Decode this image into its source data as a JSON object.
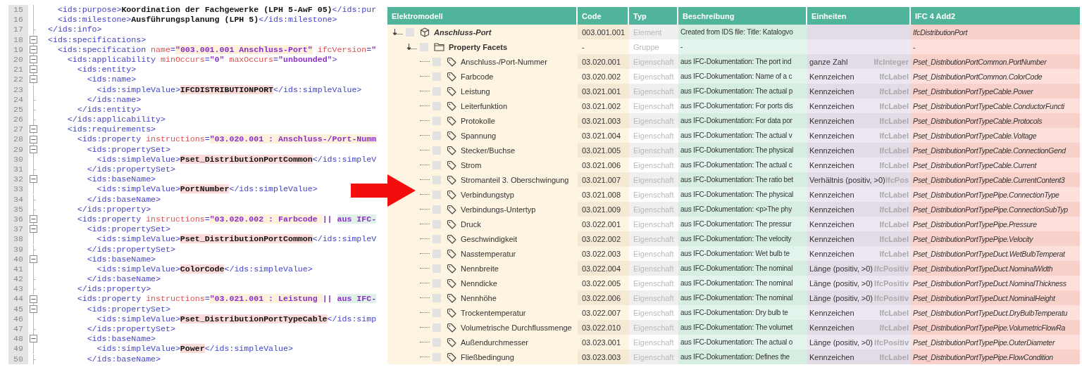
{
  "editor": {
    "lines": [
      {
        "number": "15",
        "kind": "line",
        "tokens": [
          {
            "kind": "tag",
            "text": "  <ids:purpose>"
          },
          {
            "kind": "text",
            "text": "Koordination der Fachgewerke (LPH 5-AwF 05)"
          },
          {
            "kind": "tag",
            "text": "</ids:pur"
          }
        ]
      },
      {
        "number": "16",
        "kind": "line",
        "tokens": [
          {
            "kind": "tag",
            "text": "  <ids:milestone>"
          },
          {
            "kind": "text",
            "text": "Ausführungsplanung (LPH 5)"
          },
          {
            "kind": "tag",
            "text": "</ids:milestone>"
          }
        ]
      },
      {
        "number": "17",
        "kind": "end",
        "tokens": [
          {
            "kind": "tag",
            "text": "</ids:info>"
          }
        ]
      },
      {
        "number": "18",
        "kind": "open",
        "tokens": [
          {
            "kind": "tag",
            "text": "<ids:specifications>"
          }
        ]
      },
      {
        "number": "19",
        "kind": "open",
        "tokens": [
          {
            "kind": "tag",
            "text": "  <ids:specification "
          },
          {
            "kind": "attr",
            "text": "name"
          },
          {
            "kind": "tag",
            "text": "="
          },
          {
            "kind": "value-mark",
            "text": "\"003.001.001 Anschluss-Port\""
          },
          {
            "kind": "attr",
            "text": " ifcVersion"
          },
          {
            "kind": "tag",
            "text": "="
          },
          {
            "kind": "value",
            "text": "\""
          }
        ]
      },
      {
        "number": "20",
        "kind": "open",
        "tokens": [
          {
            "kind": "tag",
            "text": "    <ids:applicability "
          },
          {
            "kind": "attr",
            "text": "minOccurs"
          },
          {
            "kind": "tag",
            "text": "="
          },
          {
            "kind": "value",
            "text": "\"0\""
          },
          {
            "kind": "attr",
            "text": " maxOccurs"
          },
          {
            "kind": "tag",
            "text": "="
          },
          {
            "kind": "value",
            "text": "\"unbounded\""
          },
          {
            "kind": "tag",
            "text": ">"
          }
        ]
      },
      {
        "number": "21",
        "kind": "open",
        "tokens": [
          {
            "kind": "tag",
            "text": "      <ids:entity>"
          }
        ]
      },
      {
        "number": "22",
        "kind": "open",
        "tokens": [
          {
            "kind": "tag",
            "text": "        <ids:name>"
          }
        ]
      },
      {
        "number": "23",
        "kind": "line",
        "tokens": [
          {
            "kind": "tag",
            "text": "          <ids:simpleValue>"
          },
          {
            "kind": "text-mark",
            "text": "IFCDISTRIBUTIONPORT"
          },
          {
            "kind": "tag",
            "text": "</ids:simpleValue>"
          }
        ]
      },
      {
        "number": "24",
        "kind": "end",
        "tokens": [
          {
            "kind": "tag",
            "text": "        </ids:name>"
          }
        ]
      },
      {
        "number": "25",
        "kind": "end",
        "tokens": [
          {
            "kind": "tag",
            "text": "      </ids:entity>"
          }
        ]
      },
      {
        "number": "26",
        "kind": "end",
        "tokens": [
          {
            "kind": "tag",
            "text": "    </ids:applicability>"
          }
        ]
      },
      {
        "number": "27",
        "kind": "open",
        "tokens": [
          {
            "kind": "tag",
            "text": "    <ids:requirements>"
          }
        ]
      },
      {
        "number": "28",
        "kind": "open",
        "tokens": [
          {
            "kind": "tag",
            "text": "      <ids:property "
          },
          {
            "kind": "attr",
            "text": "instructions"
          },
          {
            "kind": "tag",
            "text": "="
          },
          {
            "kind": "value-mark",
            "text": "\"03.020.001 : Anschluss-/Port-Numm"
          }
        ]
      },
      {
        "number": "29",
        "kind": "open",
        "tokens": [
          {
            "kind": "tag",
            "text": "        <ids:propertySet>"
          }
        ]
      },
      {
        "number": "30",
        "kind": "line",
        "tokens": [
          {
            "kind": "tag",
            "text": "          <ids:simpleValue>"
          },
          {
            "kind": "text-mark",
            "text": "Pset_DistributionPortCommon"
          },
          {
            "kind": "tag",
            "text": "</ids:simpleV"
          }
        ]
      },
      {
        "number": "31",
        "kind": "end",
        "tokens": [
          {
            "kind": "tag",
            "text": "        </ids:propertySet>"
          }
        ]
      },
      {
        "number": "32",
        "kind": "open",
        "tokens": [
          {
            "kind": "tag",
            "text": "        <ids:baseName>"
          }
        ]
      },
      {
        "number": "33",
        "kind": "line",
        "tokens": [
          {
            "kind": "tag",
            "text": "          <ids:simpleValue>"
          },
          {
            "kind": "text-mark",
            "text": "PortNumber"
          },
          {
            "kind": "tag",
            "text": "</ids:simpleValue>"
          }
        ]
      },
      {
        "number": "34",
        "kind": "end",
        "tokens": [
          {
            "kind": "tag",
            "text": "        </ids:baseName>"
          }
        ]
      },
      {
        "number": "35",
        "kind": "end",
        "tokens": [
          {
            "kind": "tag",
            "text": "      </ids:property>"
          }
        ]
      },
      {
        "number": "36",
        "kind": "open",
        "tokens": [
          {
            "kind": "tag",
            "text": "      <ids:property "
          },
          {
            "kind": "attr",
            "text": "instructions"
          },
          {
            "kind": "tag",
            "text": "="
          },
          {
            "kind": "value-mark",
            "text": "\"03.020.002 : Farbcode "
          },
          {
            "kind": "value",
            "text": "|| "
          },
          {
            "kind": "value-note",
            "text": "aus IFC-"
          }
        ]
      },
      {
        "number": "37",
        "kind": "open",
        "tokens": [
          {
            "kind": "tag",
            "text": "        <ids:propertySet>"
          }
        ]
      },
      {
        "number": "38",
        "kind": "line",
        "tokens": [
          {
            "kind": "tag",
            "text": "          <ids:simpleValue>"
          },
          {
            "kind": "text-mark",
            "text": "Pset_DistributionPortCommon"
          },
          {
            "kind": "tag",
            "text": "</ids:simpleV"
          }
        ]
      },
      {
        "number": "39",
        "kind": "end",
        "tokens": [
          {
            "kind": "tag",
            "text": "        </ids:propertySet>"
          }
        ]
      },
      {
        "number": "40",
        "kind": "open",
        "tokens": [
          {
            "kind": "tag",
            "text": "        <ids:baseName>"
          }
        ]
      },
      {
        "number": "41",
        "kind": "line",
        "tokens": [
          {
            "kind": "tag",
            "text": "          <ids:simpleValue>"
          },
          {
            "kind": "text-mark",
            "text": "ColorCode"
          },
          {
            "kind": "tag",
            "text": "</ids:simpleValue>"
          }
        ]
      },
      {
        "number": "42",
        "kind": "end",
        "tokens": [
          {
            "kind": "tag",
            "text": "        </ids:baseName>"
          }
        ]
      },
      {
        "number": "43",
        "kind": "end",
        "tokens": [
          {
            "kind": "tag",
            "text": "      </ids:property>"
          }
        ]
      },
      {
        "number": "44",
        "kind": "open",
        "tokens": [
          {
            "kind": "tag",
            "text": "      <ids:property "
          },
          {
            "kind": "attr",
            "text": "instructions"
          },
          {
            "kind": "tag",
            "text": "="
          },
          {
            "kind": "value-mark",
            "text": "\"03.021.001 : Leistung "
          },
          {
            "kind": "value",
            "text": "|| "
          },
          {
            "kind": "value-note",
            "text": "aus IFC-"
          }
        ]
      },
      {
        "number": "45",
        "kind": "open",
        "tokens": [
          {
            "kind": "tag",
            "text": "        <ids:propertySet>"
          }
        ]
      },
      {
        "number": "46",
        "kind": "line",
        "tokens": [
          {
            "kind": "tag",
            "text": "          <ids:simpleValue>"
          },
          {
            "kind": "text-mark",
            "text": "Pset_DistributionPortTypeCable"
          },
          {
            "kind": "tag",
            "text": "</ids:simp"
          }
        ]
      },
      {
        "number": "47",
        "kind": "end",
        "tokens": [
          {
            "kind": "tag",
            "text": "        </ids:propertySet>"
          }
        ]
      },
      {
        "number": "48",
        "kind": "open",
        "tokens": [
          {
            "kind": "tag",
            "text": "        <ids:baseName>"
          }
        ]
      },
      {
        "number": "49",
        "kind": "line",
        "tokens": [
          {
            "kind": "tag",
            "text": "          <ids:simpleValue>"
          },
          {
            "kind": "text-mark",
            "text": "Power"
          },
          {
            "kind": "tag",
            "text": "</ids:simpleValue>"
          }
        ]
      },
      {
        "number": "50",
        "kind": "end",
        "tokens": [
          {
            "kind": "tag",
            "text": "        </ids:baseName>"
          }
        ]
      }
    ]
  },
  "table": {
    "columns": [
      "Elektromodell",
      "Code",
      "Typ",
      "Beschreibung",
      "Einheiten",
      "IFC 4 Add2"
    ],
    "tree": [
      {
        "kind": "element",
        "name": "Anschluss-Port",
        "code": "003.001.001",
        "type": "Element",
        "description": "Created from IDS file: Title: Katalogvo",
        "ifc": "IfcDistributionPort",
        "checked": false,
        "expanded": true,
        "children": [
          {
            "kind": "group",
            "name": "Property Facets",
            "code": "-",
            "type": "Gruppe",
            "description": "-",
            "ifc": "-",
            "checked": false,
            "expanded": true,
            "children": [
              {
                "kind": "property",
                "name": "Anschluss-/Port-Nummer",
                "code": "03.020.001",
                "type": "Eigenschaft",
                "description": "aus IFC-Dokumentation: The port ind",
                "unit": "ganze Zahl",
                "unit_type": "IfcInteger",
                "ifc": "Pset_DistributionPortCommon.PortNumber",
                "checked": false
              },
              {
                "kind": "property",
                "name": "Farbcode",
                "code": "03.020.002",
                "type": "Eigenschaft",
                "description": "aus IFC-Dokumentation: Name of a c",
                "unit": "Kennzeichen",
                "unit_type": "IfcLabel",
                "ifc": "Pset_DistributionPortCommon.ColorCode",
                "checked": false
              },
              {
                "kind": "property",
                "name": "Leistung",
                "code": "03.021.001",
                "type": "Eigenschaft",
                "description": "aus IFC-Dokumentation: The actual p",
                "unit": "Kennzeichen",
                "unit_type": "IfcLabel",
                "ifc": "Pset_DistributionPortTypeCable.Power",
                "checked": false
              },
              {
                "kind": "property",
                "name": "Leiterfunktion",
                "code": "03.021.002",
                "type": "Eigenschaft",
                "description": "aus IFC-Dokumentation: For ports dis",
                "unit": "Kennzeichen",
                "unit_type": "IfcLabel",
                "ifc": "Pset_DistributionPortTypeCable.ConductorFuncti",
                "checked": false
              },
              {
                "kind": "property",
                "name": "Protokolle",
                "code": "03.021.003",
                "type": "Eigenschaft",
                "description": "aus IFC-Dokumentation: For data por",
                "unit": "Kennzeichen",
                "unit_type": "IfcLabel",
                "ifc": "Pset_DistributionPortTypeCable.Protocols",
                "checked": false
              },
              {
                "kind": "property",
                "name": "Spannung",
                "code": "03.021.004",
                "type": "Eigenschaft",
                "description": "aus IFC-Dokumentation: The actual v",
                "unit": "Kennzeichen",
                "unit_type": "IfcLabel",
                "ifc": "Pset_DistributionPortTypeCable.Voltage",
                "checked": false
              },
              {
                "kind": "property",
                "name": "Stecker/Buchse",
                "code": "03.021.005",
                "type": "Eigenschaft",
                "description": "aus IFC-Dokumentation: The physical",
                "unit": "Kennzeichen",
                "unit_type": "IfcLabel",
                "ifc": "Pset_DistributionPortTypeCable.ConnectionGend",
                "checked": false
              },
              {
                "kind": "property",
                "name": "Strom",
                "code": "03.021.006",
                "type": "Eigenschaft",
                "description": "aus IFC-Dokumentation: The actual c",
                "unit": "Kennzeichen",
                "unit_type": "IfcLabel",
                "ifc": "Pset_DistributionPortTypeCable.Current",
                "checked": false
              },
              {
                "kind": "property",
                "name": "Stromanteil 3. Oberschwingung",
                "code": "03.021.007",
                "type": "Eigenschaft",
                "description": "aus IFC-Dokumentation: The ratio bet",
                "unit": "Verhältnis (positiv, >0)",
                "unit_type": "IfcPos",
                "ifc": "Pset_DistributionPortTypeCable.CurrentContent3",
                "checked": false
              },
              {
                "kind": "property",
                "name": "Verbindungstyp",
                "code": "03.021.008",
                "type": "Eigenschaft",
                "description": "aus IFC-Dokumentation: The physical",
                "unit": "Kennzeichen",
                "unit_type": "IfcLabel",
                "ifc": "Pset_DistributionPortTypePipe.ConnectionType",
                "checked": false
              },
              {
                "kind": "property",
                "name": "Verbindungs-Untertyp",
                "code": "03.021.009",
                "type": "Eigenschaft",
                "description": "aus IFC-Dokumentation: <p>The phy",
                "unit": "Kennzeichen",
                "unit_type": "IfcLabel",
                "ifc": "Pset_DistributionPortTypePipe.ConnectionSubTyp",
                "checked": false
              },
              {
                "kind": "property",
                "name": "Druck",
                "code": "03.022.001",
                "type": "Eigenschaft",
                "description": "aus IFC-Dokumentation: The pressur",
                "unit": "Kennzeichen",
                "unit_type": "IfcLabel",
                "ifc": "Pset_DistributionPortTypePipe.Pressure",
                "checked": false
              },
              {
                "kind": "property",
                "name": "Geschwindigkeit",
                "code": "03.022.002",
                "type": "Eigenschaft",
                "description": "aus IFC-Dokumentation: The velocity",
                "unit": "Kennzeichen",
                "unit_type": "IfcLabel",
                "ifc": "Pset_DistributionPortTypePipe.Velocity",
                "checked": false
              },
              {
                "kind": "property",
                "name": "Nasstemperatur",
                "code": "03.022.003",
                "type": "Eigenschaft",
                "description": "aus IFC-Dokumentation: Wet bulb te",
                "unit": "Kennzeichen",
                "unit_type": "IfcLabel",
                "ifc": "Pset_DistributionPortTypeDuct.WetBulbTemperat",
                "checked": false
              },
              {
                "kind": "property",
                "name": "Nennbreite",
                "code": "03.022.004",
                "type": "Eigenschaft",
                "description": "aus IFC-Dokumentation: The nominal",
                "unit": "Länge (positiv, >0)",
                "unit_type": "IfcPositiv",
                "ifc": "Pset_DistributionPortTypeDuct.NominalWidth",
                "checked": false
              },
              {
                "kind": "property",
                "name": "Nenndicke",
                "code": "03.022.005",
                "type": "Eigenschaft",
                "description": "aus IFC-Dokumentation: The nominal",
                "unit": "Länge (positiv, >0)",
                "unit_type": "IfcPositiv",
                "ifc": "Pset_DistributionPortTypeDuct.NominalThickness",
                "checked": false
              },
              {
                "kind": "property",
                "name": "Nennhöhe",
                "code": "03.022.006",
                "type": "Eigenschaft",
                "description": "aus IFC-Dokumentation: The nominal",
                "unit": "Länge (positiv, >0)",
                "unit_type": "IfcPositiv",
                "ifc": "Pset_DistributionPortTypeDuct.NominalHeight",
                "checked": false
              },
              {
                "kind": "property",
                "name": "Trockentemperatur",
                "code": "03.022.007",
                "type": "Eigenschaft",
                "description": "aus IFC-Dokumentation: Dry bulb te",
                "unit": "Kennzeichen",
                "unit_type": "IfcLabel",
                "ifc": "Pset_DistributionPortTypeDuct.DryBulbTemperatu",
                "checked": false
              },
              {
                "kind": "property",
                "name": "Volumetrische Durchflussmenge",
                "code": "03.022.010",
                "type": "Eigenschaft",
                "description": "aus IFC-Dokumentation: The volumet",
                "unit": "Kennzeichen",
                "unit_type": "IfcLabel",
                "ifc": "Pset_DistributionPortTypePipe.VolumetricFlowRa",
                "checked": false
              },
              {
                "kind": "property",
                "name": "Außendurchmesser",
                "code": "03.023.001",
                "type": "Eigenschaft",
                "description": "aus IFC-Dokumentation: The actual o",
                "unit": "Länge (positiv, >0)",
                "unit_type": "IfcPositiv",
                "ifc": "Pset_DistributionPortTypePipe.OuterDiameter",
                "checked": false
              },
              {
                "kind": "property",
                "name": "Fließbedingung",
                "code": "03.023.003",
                "type": "Eigenschaft",
                "description": "aus IFC-Dokumentation: Defines the",
                "unit": "Kennzeichen",
                "unit_type": "IfcLabel",
                "ifc": "Pset_DistributionPortTypePipe.FlowCondition",
                "checked": false
              }
            ]
          }
        ]
      }
    ]
  }
}
